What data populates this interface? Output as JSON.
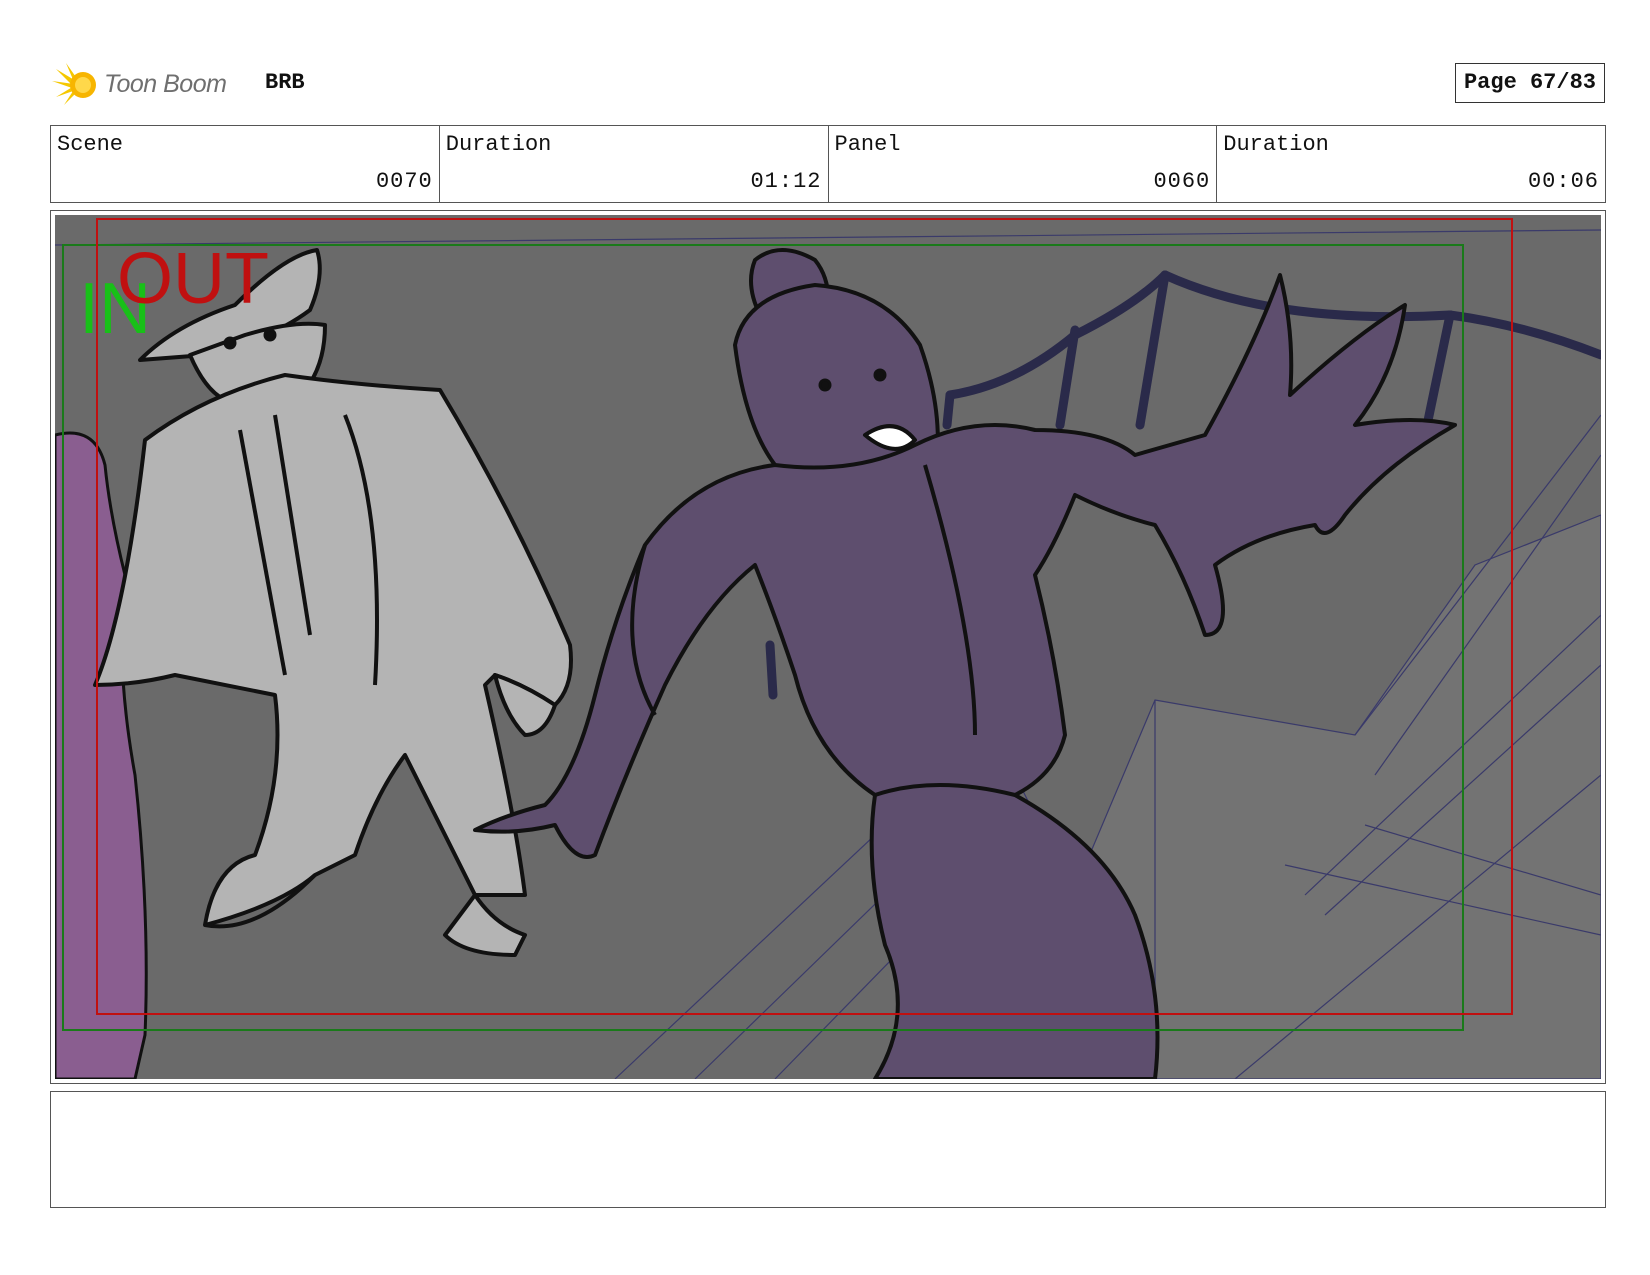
{
  "header": {
    "logo_text": "Toon Boom",
    "project": "BRB",
    "page_label": "Page 67/83"
  },
  "info": {
    "scene_label": "Scene",
    "scene_value": "0070",
    "scene_duration_label": "Duration",
    "scene_duration_value": "01:12",
    "panel_label": "Panel",
    "panel_value": "0060",
    "panel_duration_label": "Duration",
    "panel_duration_value": "00:06"
  },
  "panel": {
    "in_marker": "IN",
    "out_marker": "OUT",
    "colors": {
      "background": "#6a6a6a",
      "purple": "#5e4e6e",
      "grey_character": "#b4b4b4",
      "safe_frame_green": "#1a7a1a",
      "camera_frame_red": "#c01010",
      "rope": "#2a2a4a"
    }
  },
  "notes": {
    "text": ""
  }
}
